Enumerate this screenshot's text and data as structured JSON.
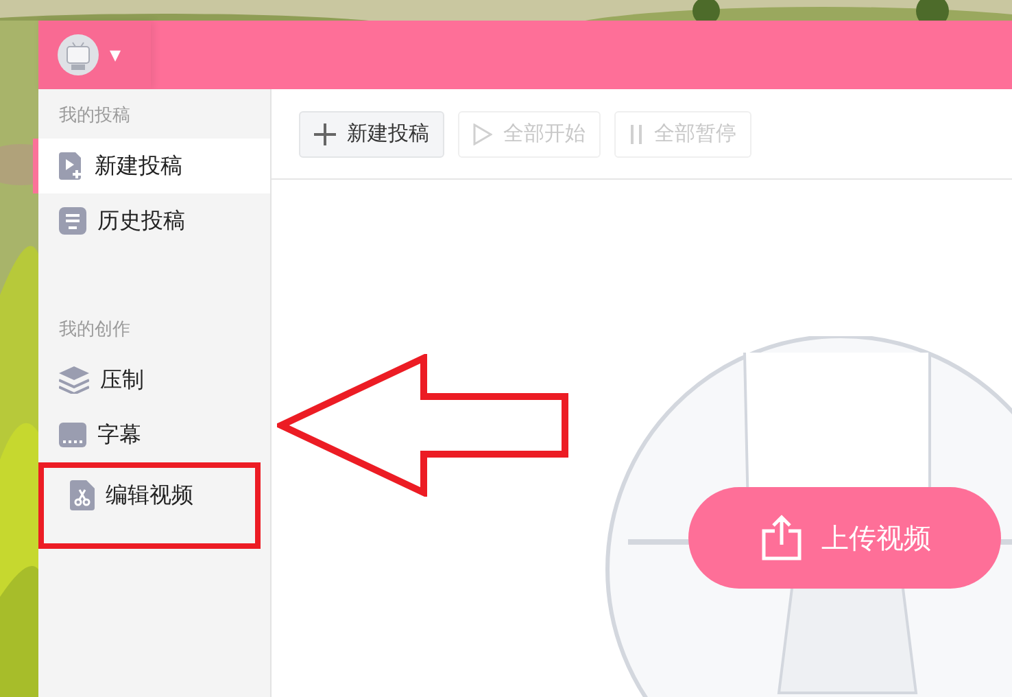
{
  "header": {
    "dropdown": "▾"
  },
  "sidebar": {
    "sections": [
      {
        "title": "我的投稿",
        "items": [
          {
            "label": "新建投稿",
            "selected": true
          },
          {
            "label": "历史投稿",
            "selected": false
          }
        ]
      },
      {
        "title": "我的创作",
        "items": [
          {
            "label": "压制",
            "selected": false
          },
          {
            "label": "字幕",
            "selected": false
          },
          {
            "label": "编辑视频",
            "selected": false
          }
        ]
      }
    ]
  },
  "toolbar": {
    "buttons": [
      {
        "label": "新建投稿",
        "disabled": false
      },
      {
        "label": "全部开始",
        "disabled": true
      },
      {
        "label": "全部暂停",
        "disabled": true
      }
    ]
  },
  "upload_button": {
    "label": "上传视频"
  }
}
